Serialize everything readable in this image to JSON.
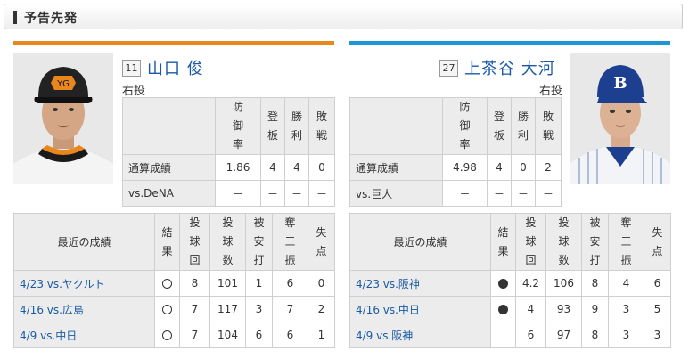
{
  "section_title": "予告先発",
  "left": {
    "number": "11",
    "name": "山口 俊",
    "hand": "右投",
    "stats_headers": [
      "防御率",
      "登板",
      "勝利",
      "敗戦"
    ],
    "stats_rows": [
      {
        "label": "通算成績",
        "values": [
          "1.86",
          "4",
          "4",
          "0"
        ]
      },
      {
        "label": "vs.DeNA",
        "values": [
          "－",
          "－",
          "－",
          "－"
        ]
      }
    ],
    "recent_headers": [
      "最近の成績",
      "結果",
      "投球回",
      "投球数",
      "被安打",
      "奪三振",
      "失点"
    ],
    "recent_rows": [
      {
        "game": "4/23 vs.ヤクルト",
        "result": "win",
        "values": [
          "8",
          "101",
          "1",
          "6",
          "0"
        ]
      },
      {
        "game": "4/16 vs.広島",
        "result": "win",
        "values": [
          "7",
          "117",
          "3",
          "7",
          "2"
        ]
      },
      {
        "game": "4/9 vs.中日",
        "result": "win",
        "values": [
          "7",
          "104",
          "6",
          "6",
          "1"
        ]
      }
    ]
  },
  "right": {
    "number": "27",
    "name": "上茶谷 大河",
    "hand": "右投",
    "stats_headers": [
      "防御率",
      "登板",
      "勝利",
      "敗戦"
    ],
    "stats_rows": [
      {
        "label": "通算成績",
        "values": [
          "4.98",
          "4",
          "0",
          "2"
        ]
      },
      {
        "label": "vs.巨人",
        "values": [
          "－",
          "－",
          "－",
          "－"
        ]
      }
    ],
    "recent_headers": [
      "最近の成績",
      "結果",
      "投球回",
      "投球数",
      "被安打",
      "奪三振",
      "失点"
    ],
    "recent_rows": [
      {
        "game": "4/23 vs.阪神",
        "result": "loss",
        "values": [
          "4.2",
          "106",
          "8",
          "4",
          "6"
        ]
      },
      {
        "game": "4/16 vs.中日",
        "result": "loss",
        "values": [
          "4",
          "93",
          "9",
          "3",
          "5"
        ]
      },
      {
        "game": "4/9 vs.阪神",
        "result": "",
        "values": [
          "6",
          "97",
          "8",
          "3",
          "3"
        ]
      }
    ]
  }
}
